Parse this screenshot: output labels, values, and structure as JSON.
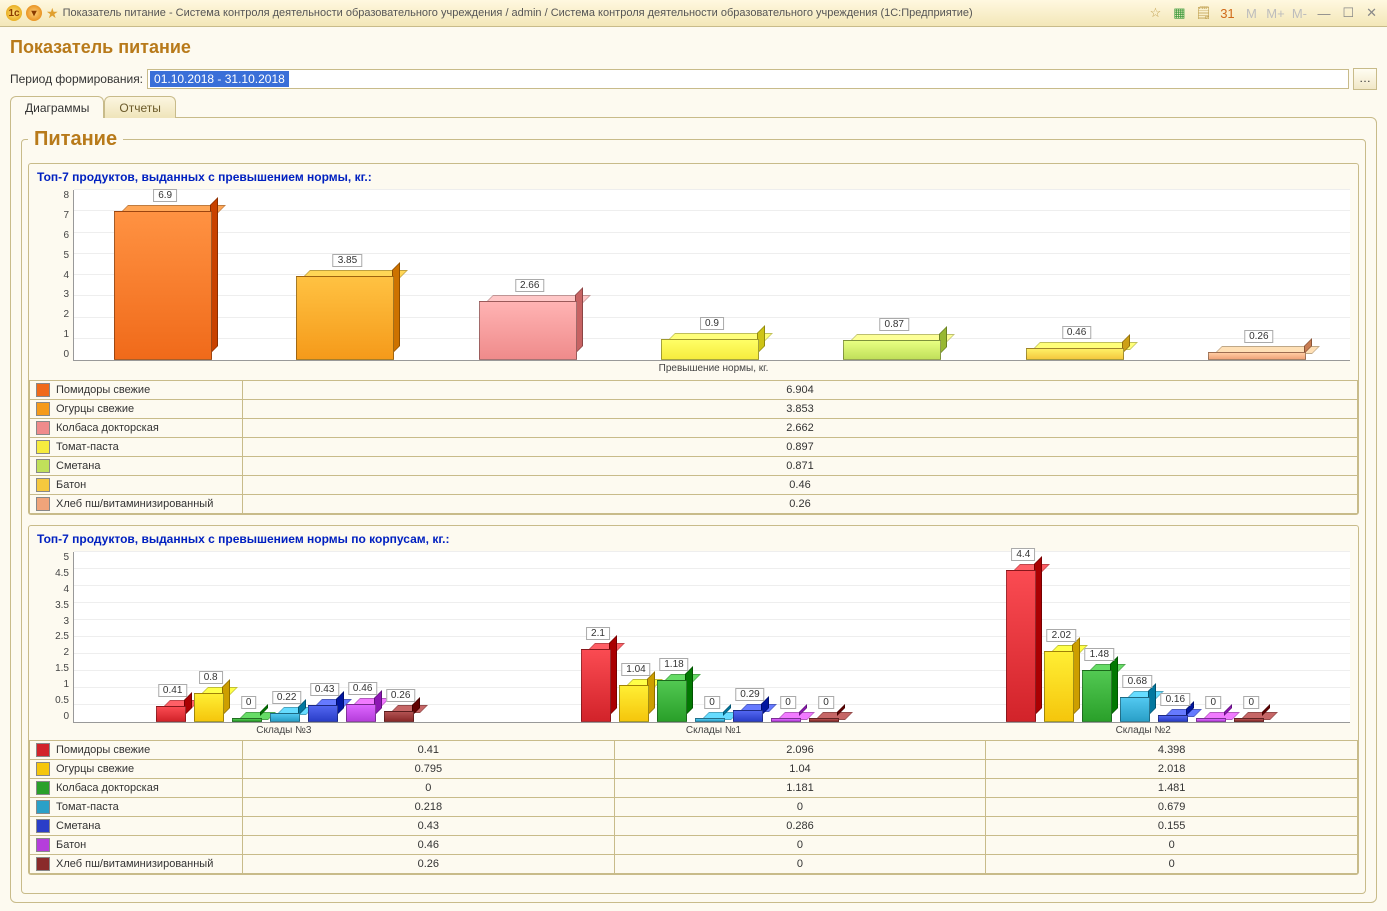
{
  "titlebar": {
    "text": "Показатель питание - Система контроля деятельности образовательного учреждения / admin / Система контроля деятельности образовательного учреждения   (1С:Предприятие)"
  },
  "page_title": "Показатель питание",
  "period": {
    "label": "Период формирования:",
    "value": "01.10.2018 - 31.10.2018"
  },
  "tabs": {
    "diagrams": "Диаграммы",
    "reports": "Отчеты"
  },
  "fieldset_title": "Питание",
  "chart1": {
    "title": "Топ-7 продуктов, выданных с превышением нормы, кг.:",
    "xlabel": "Превышение нормы, кг."
  },
  "chart2": {
    "title": "Топ-7 продуктов, выданных с превышением нормы по корпусам, кг.:"
  },
  "chart_data": [
    {
      "type": "bar",
      "title": "Топ-7 продуктов, выданных с превышением нормы, кг.",
      "xlabel": "Превышение нормы, кг.",
      "ylabel": "",
      "ylim": [
        0,
        8
      ],
      "yticks": [
        0,
        1,
        2,
        3,
        4,
        5,
        6,
        7,
        8
      ],
      "series": [
        {
          "name": "Помидоры свежие",
          "bar_label": "6.9",
          "value": 6.904,
          "color": "#f06a1a"
        },
        {
          "name": "Огурцы свежие",
          "bar_label": "3.85",
          "value": 3.853,
          "color": "#f59a1a"
        },
        {
          "name": "Колбаса докторская",
          "bar_label": "2.66",
          "value": 2.662,
          "color": "#ef8b8b"
        },
        {
          "name": "Томат-паста",
          "bar_label": "0.9",
          "value": 0.897,
          "color": "#f6ec3e"
        },
        {
          "name": "Сметана",
          "bar_label": "0.87",
          "value": 0.871,
          "color": "#c0e05a"
        },
        {
          "name": "Батон",
          "bar_label": "0.46",
          "value": 0.46,
          "color": "#f5c83e"
        },
        {
          "name": "Хлеб пш/витаминизированный",
          "bar_label": "0.26",
          "value": 0.26,
          "color": "#f0a47a"
        }
      ]
    },
    {
      "type": "bar",
      "title": "Топ-7 продуктов, выданных с превышением нормы по корпусам, кг.",
      "ylabel": "",
      "ylim": [
        0,
        5
      ],
      "yticks": [
        0,
        0.5,
        1,
        1.5,
        2,
        2.5,
        3,
        3.5,
        4,
        4.5,
        5
      ],
      "categories": [
        "Склады №3",
        "Склады №1",
        "Склады №2"
      ],
      "series_meta": [
        {
          "name": "Помидоры свежие",
          "color": "#d2232a"
        },
        {
          "name": "Огурцы свежие",
          "color": "#f5c60c"
        },
        {
          "name": "Колбаса докторская",
          "color": "#2aa02a"
        },
        {
          "name": "Томат-паста",
          "color": "#2aa0c8"
        },
        {
          "name": "Сметана",
          "color": "#2a3ec8"
        },
        {
          "name": "Батон",
          "color": "#b53edb"
        },
        {
          "name": "Хлеб пш/витаминизированный",
          "color": "#8a2a2a"
        }
      ],
      "groups": [
        {
          "cat": "Склады №3",
          "bars": [
            {
              "label": "0.41",
              "value": 0.41
            },
            {
              "label": "0.8",
              "value": 0.795
            },
            {
              "label": "0",
              "value": 0
            },
            {
              "label": "0.22",
              "value": 0.218
            },
            {
              "label": "0.43",
              "value": 0.43
            },
            {
              "label": "0.46",
              "value": 0.46
            },
            {
              "label": "0.26",
              "value": 0.26
            }
          ]
        },
        {
          "cat": "Склады №1",
          "bars": [
            {
              "label": "2.1",
              "value": 2.096
            },
            {
              "label": "1.04",
              "value": 1.04
            },
            {
              "label": "1.18",
              "value": 1.181
            },
            {
              "label": "0",
              "value": 0
            },
            {
              "label": "0.29",
              "value": 0.286
            },
            {
              "label": "0",
              "value": 0
            },
            {
              "label": "0",
              "value": 0
            }
          ]
        },
        {
          "cat": "Склады №2",
          "bars": [
            {
              "label": "4.4",
              "value": 4.398
            },
            {
              "label": "2.02",
              "value": 2.018
            },
            {
              "label": "1.48",
              "value": 1.481
            },
            {
              "label": "0.68",
              "value": 0.679
            },
            {
              "label": "0.16",
              "value": 0.155
            },
            {
              "label": "0",
              "value": 0
            },
            {
              "label": "0",
              "value": 0
            }
          ]
        }
      ]
    }
  ]
}
